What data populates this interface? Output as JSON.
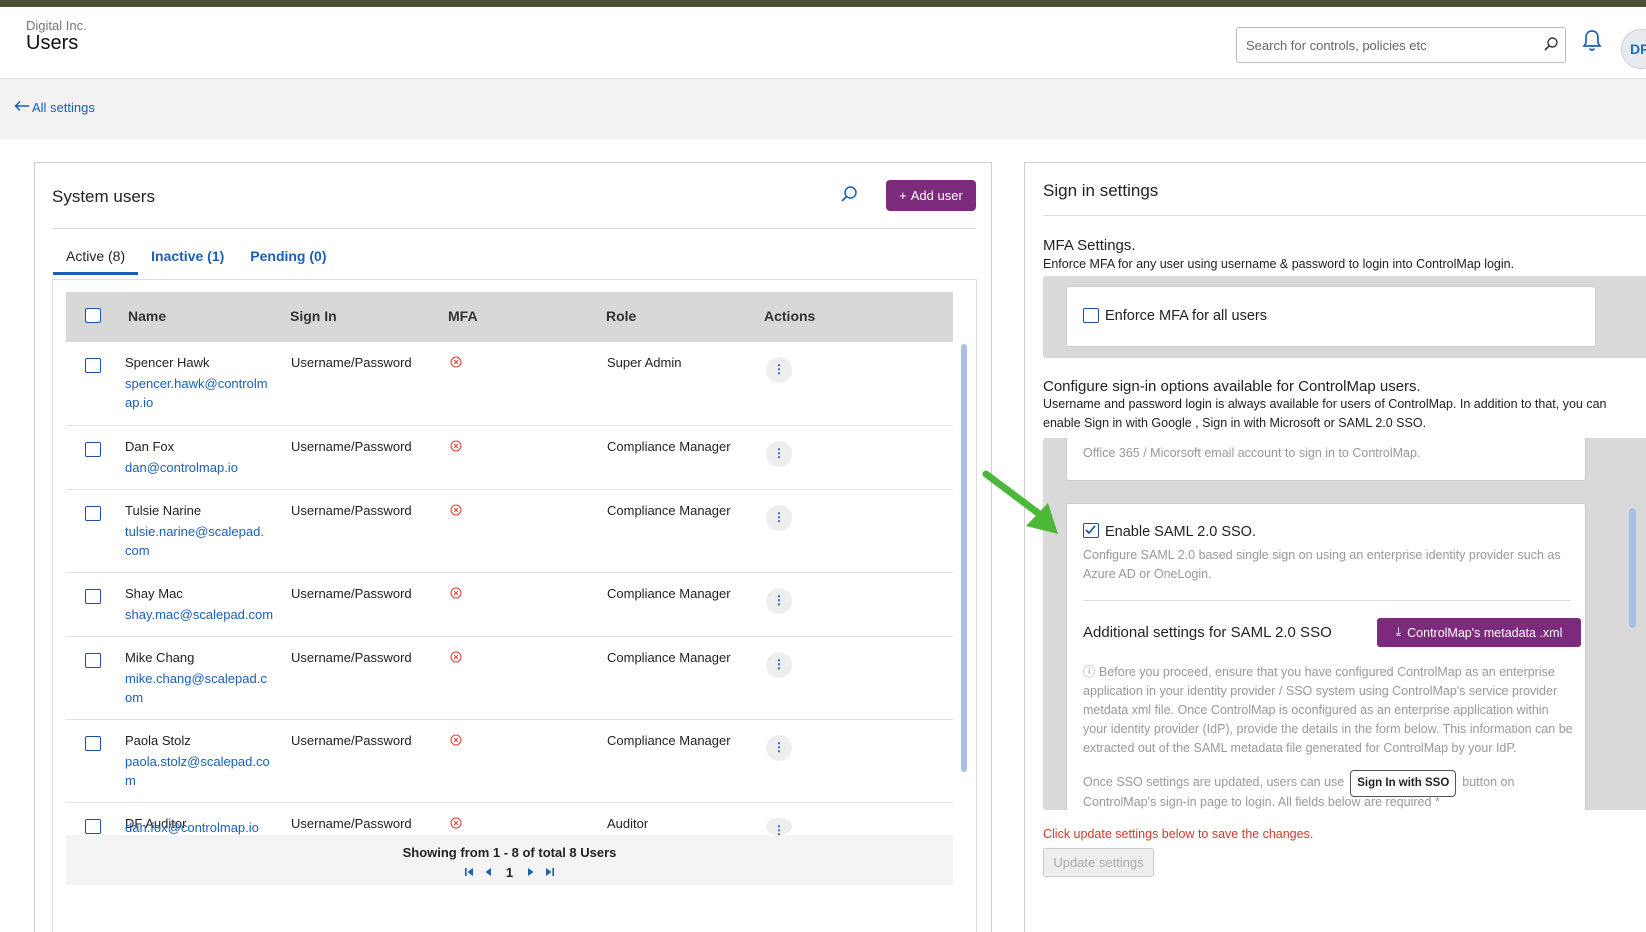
{
  "header": {
    "org": "Digital Inc.",
    "title": "Users",
    "search_placeholder": "Search for controls, policies etc",
    "avatar": "DF"
  },
  "nav": {
    "back_label": "All settings"
  },
  "system_users": {
    "title": "System users",
    "add_user_label": "Add user",
    "tabs": [
      {
        "label": "Active (8)",
        "active": true
      },
      {
        "label": "Inactive (1)",
        "active": false
      },
      {
        "label": "Pending (0)",
        "active": false
      }
    ],
    "columns": [
      "Name",
      "Sign In",
      "MFA",
      "Role",
      "Actions"
    ],
    "rows": [
      {
        "name": "Spencer Hawk",
        "email": "spencer.hawk@controlmap.io",
        "sign_in": "Username/Password",
        "role": "Super Admin"
      },
      {
        "name": "Dan Fox",
        "email": "dan@controlmap.io",
        "sign_in": "Username/Password",
        "role": "Compliance Manager"
      },
      {
        "name": "Tulsie Narine",
        "email": "tulsie.narine@scalepad.com",
        "sign_in": "Username/Password",
        "role": "Compliance Manager"
      },
      {
        "name": "Shay Mac",
        "email": "shay.mac@scalepad.com",
        "sign_in": "Username/Password",
        "role": "Compliance Manager"
      },
      {
        "name": "Mike Chang",
        "email": "mike.chang@scalepad.com",
        "sign_in": "Username/Password",
        "role": "Compliance Manager"
      },
      {
        "name": "Paola Stolz",
        "email": "paola.stolz@scalepad.com",
        "sign_in": "Username/Password",
        "role": "Compliance Manager"
      },
      {
        "name": "DF Auditor",
        "email": "dan.fox@controlmap.io",
        "sign_in": "Username/Password",
        "role": "Auditor"
      }
    ],
    "showing": "Showing from 1 - 8 of total 8 Users",
    "page": "1"
  },
  "sign_in_settings": {
    "title": "Sign in settings",
    "mfa_title": "MFA Settings.",
    "mfa_desc": "Enforce MFA for any user using username & password to login into ControlMap login.",
    "enforce_mfa_label": "Enforce MFA for all users",
    "configure_title": "Configure sign-in options available for ControlMap users.",
    "configure_desc": "Username and password login is always available for users of ControlMap. In addition to that, you can enable Sign in with Google , Sign in with Microsoft or SAML 2.0 SSO.",
    "microsoft_desc_tail": "Office 365 / Micorsoft email account to sign in to ControlMap.",
    "saml_label": "Enable SAML 2.0 SSO.",
    "saml_desc": "Configure SAML 2.0 based single sign on using an enterprise identity provider such as Azure AD or OneLogin.",
    "saml_additional_title": "Additional settings for SAML 2.0 SSO",
    "metadata_button": "ControlMap's metadata .xml",
    "saml_info": "Before you proceed, ensure that you have configured ControlMap as an enterprise application in your identity provider / SSO system using ControlMap's service provider metdata xml file. Once ControlMap is oconfigured as an enterprise application within your identity provider (IdP), provide the details in the form below. This information can be extracted out of the SAML metadata file generated for ControlMap by your IdP.",
    "sso_note_before": "Once SSO settings are updated, users can use",
    "sso_button": "Sign In with SSO",
    "sso_note_after": "button on",
    "sso_note_cut": "ControlMap's sign-in page to login. All fields below are required *",
    "warning": "Click update settings below to save the changes.",
    "update_button": "Update settings"
  },
  "colors": {
    "accent": "#7c2a7c",
    "link": "#1a5fb4",
    "warning": "#d03b2b",
    "mfa_off": "#e0443a",
    "annotation_arrow": "#4cb83a"
  }
}
